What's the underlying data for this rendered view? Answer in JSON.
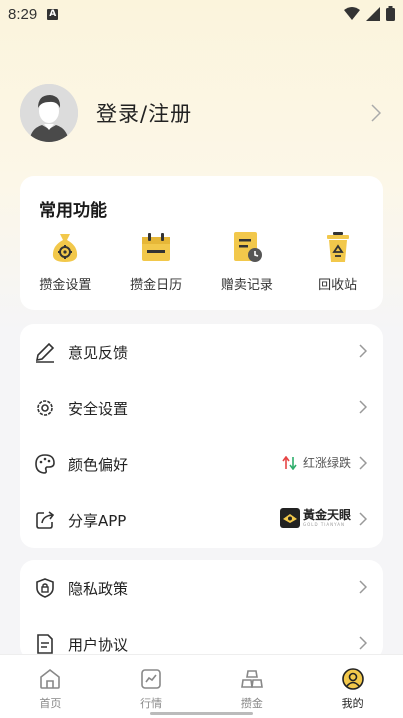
{
  "status_bar": {
    "time": "8:29",
    "notification_icon": "A"
  },
  "profile": {
    "name": "登录/注册"
  },
  "quick_functions": {
    "title": "常用功能",
    "items": [
      {
        "label": "攒金设置",
        "icon": "money-bag-gear-icon"
      },
      {
        "label": "攒金日历",
        "icon": "calendar-icon"
      },
      {
        "label": "赠卖记录",
        "icon": "record-clock-icon"
      },
      {
        "label": "回收站",
        "icon": "recycle-bin-icon"
      }
    ]
  },
  "menu_group_1": [
    {
      "label": "意见反馈",
      "icon": "pen-icon"
    },
    {
      "label": "安全设置",
      "icon": "gear-icon"
    },
    {
      "label": "颜色偏好",
      "icon": "palette-icon",
      "extra": "红涨绿跌"
    },
    {
      "label": "分享APP",
      "icon": "share-icon",
      "extra": "黃金天眼",
      "extra_sub": "GOLD TIANYAN"
    }
  ],
  "menu_group_2": [
    {
      "label": "隐私政策",
      "icon": "shield-lock-icon"
    },
    {
      "label": "用户协议",
      "icon": "document-icon"
    }
  ],
  "tabbar": [
    {
      "label": "首页",
      "icon": "home-icon",
      "active": false
    },
    {
      "label": "行情",
      "icon": "chart-icon",
      "active": false
    },
    {
      "label": "攒金",
      "icon": "gold-bars-icon",
      "active": false
    },
    {
      "label": "我的",
      "icon": "profile-icon",
      "active": true
    }
  ],
  "colors": {
    "accent_gold": "#f2c84b",
    "up_red": "#e64545",
    "down_green": "#2fae6c"
  }
}
